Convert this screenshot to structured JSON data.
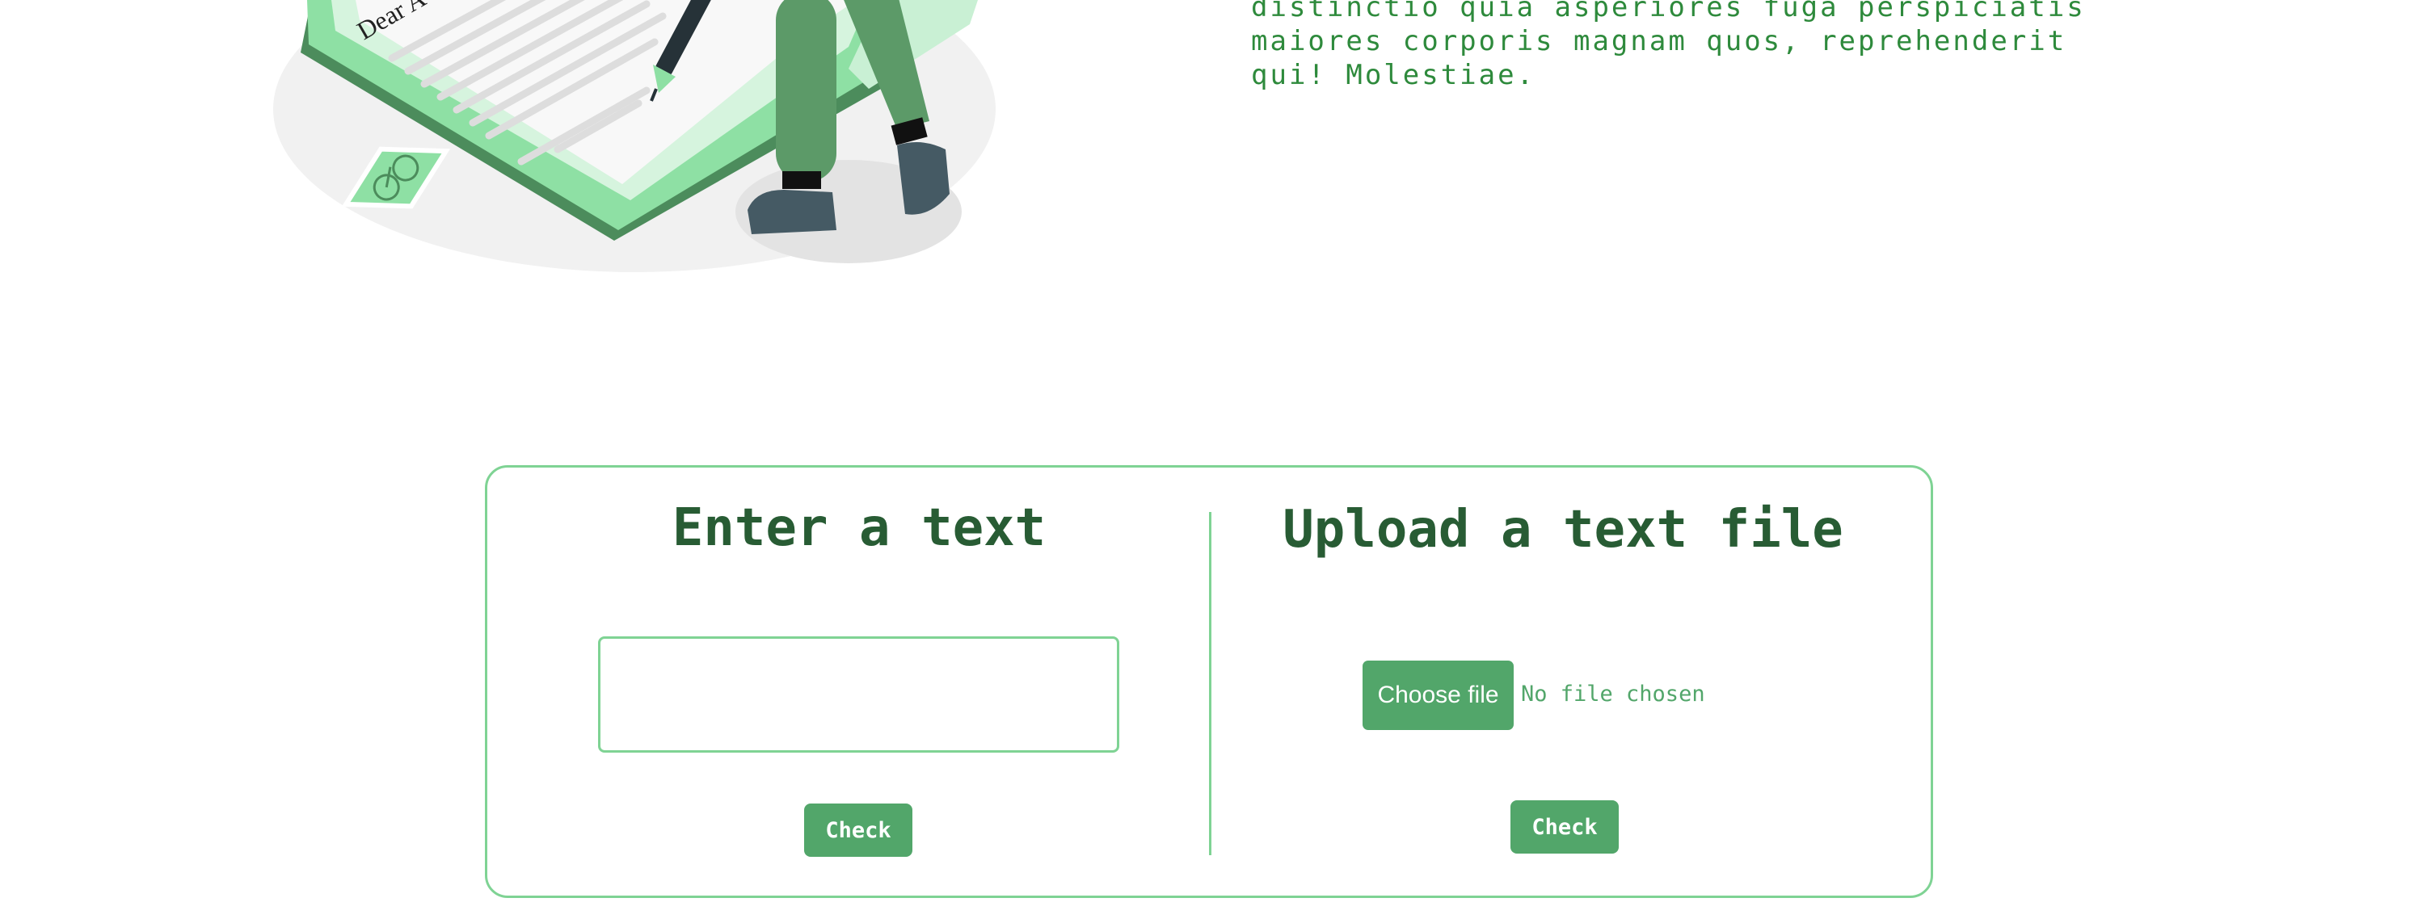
{
  "intro": {
    "paragraph": "distinctio quia asperiores fuga perspiciatis\nmaiores corporis magnam quos, reprehenderit\nqui! Molestiae."
  },
  "illustration": {
    "letter_text": "Dear A"
  },
  "text_checker": {
    "title": "Enter a text",
    "input_value": "",
    "input_placeholder": "",
    "check_label": "Check"
  },
  "file_checker": {
    "title": "Upload a text file",
    "choose_label": "Choose file",
    "file_status": "No file chosen",
    "check_label": "Check"
  },
  "colors": {
    "accent": "#52a66a",
    "border": "#7fd394",
    "heading": "#285c34",
    "text": "#2e8a3c"
  }
}
